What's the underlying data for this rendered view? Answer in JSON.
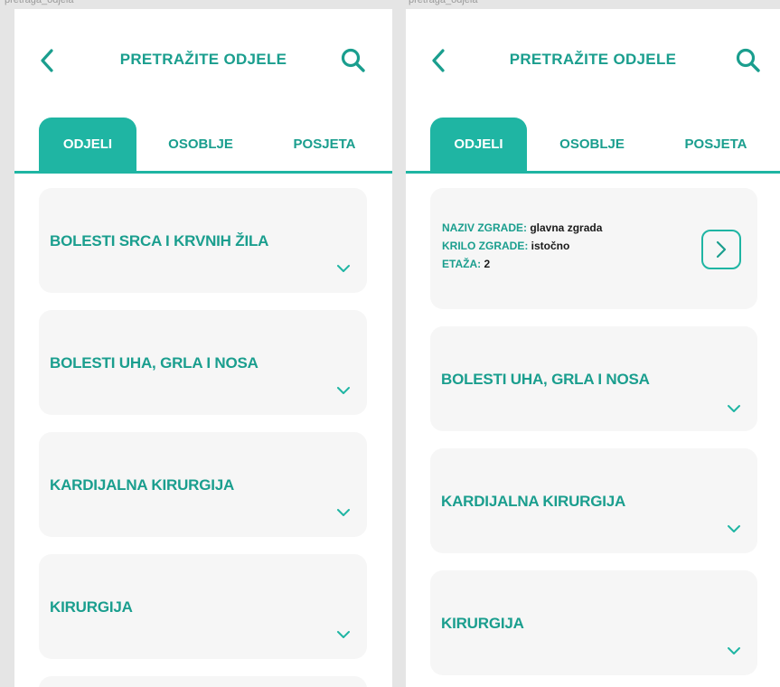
{
  "frames": [
    {
      "label": "pretraga_odjela"
    },
    {
      "label": "pretraga_odjela"
    }
  ],
  "header": {
    "title": "PRETRAŽITE ODJELE",
    "back_icon": "chevron-left-icon",
    "search_icon": "search-icon"
  },
  "tabs": [
    {
      "label": "ODJELI",
      "active": true
    },
    {
      "label": "OSOBLJE",
      "active": false
    },
    {
      "label": "POSJETA",
      "active": false
    }
  ],
  "colors": {
    "accent": "#1fb5a3",
    "accent_text": "#1a9e8e",
    "card_bg": "#f6f6f6"
  },
  "left_list": {
    "items": [
      {
        "label": "BOLESTI SRCA I KRVNIH ŽILA"
      },
      {
        "label": "BOLESTI UHA, GRLA I NOSA"
      },
      {
        "label": "KARDIJALNA KIRURGIJA"
      },
      {
        "label": "KIRURGIJA"
      }
    ]
  },
  "right_list": {
    "expanded_card": {
      "building_name_label": "NAZIV ZGRADE:",
      "building_name_value": "glavna zgrada",
      "wing_label": "KRILO ZGRADE:",
      "wing_value": "istočno",
      "floor_label": "ETAŽA:",
      "floor_value": "2"
    },
    "items": [
      {
        "label": "BOLESTI UHA, GRLA I NOSA"
      },
      {
        "label": "KARDIJALNA KIRURGIJA"
      },
      {
        "label": "KIRURGIJA"
      }
    ]
  }
}
